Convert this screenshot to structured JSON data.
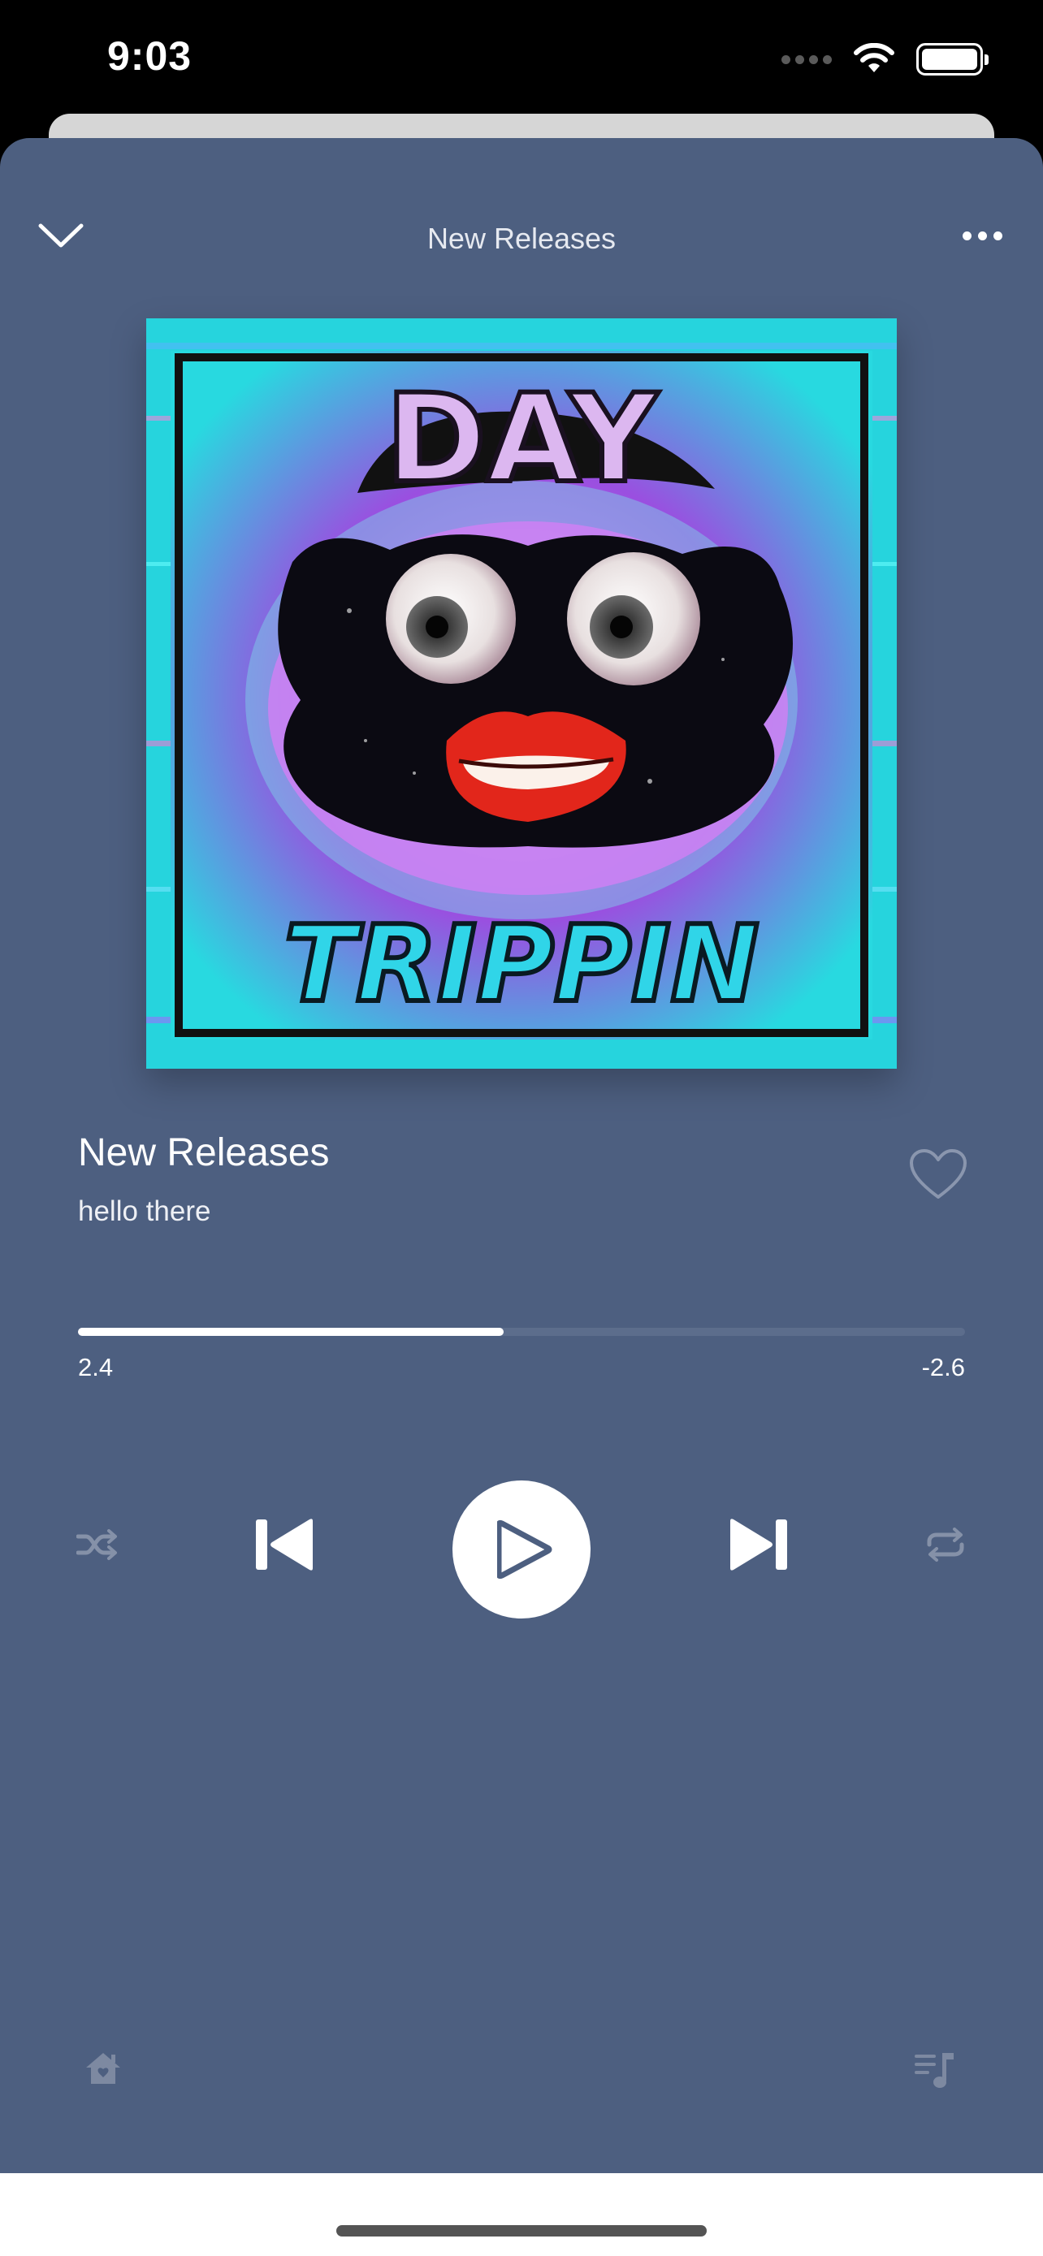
{
  "status_bar": {
    "time": "9:03",
    "icons": [
      "signal-dots-icon",
      "wifi-icon",
      "battery-icon"
    ]
  },
  "player": {
    "header_title": "New Releases",
    "collapse_icon": "chevron-down-icon",
    "more_icon": "more-horizontal-icon",
    "artwork": {
      "lettering_top": "DAY",
      "lettering_bottom": "TRIPPIN"
    },
    "track": {
      "title": "New Releases",
      "artist": "hello there",
      "liked": false
    },
    "progress": {
      "fraction": 0.48,
      "elapsed": "2.4",
      "remaining": "-2.6"
    },
    "controls": {
      "shuffle_icon": "shuffle-icon",
      "previous_icon": "skip-previous-icon",
      "play_icon": "play-icon",
      "next_icon": "skip-next-icon",
      "repeat_icon": "repeat-icon"
    }
  },
  "bottom_bar": {
    "left_icon": "home-icon",
    "right_icon": "queue-music-icon"
  },
  "colors": {
    "sheet_background": "#4d5f80",
    "progress_track": "#5c6d8c",
    "progress_fill": "#ffffff",
    "inactive_icon": "#8591a8"
  }
}
